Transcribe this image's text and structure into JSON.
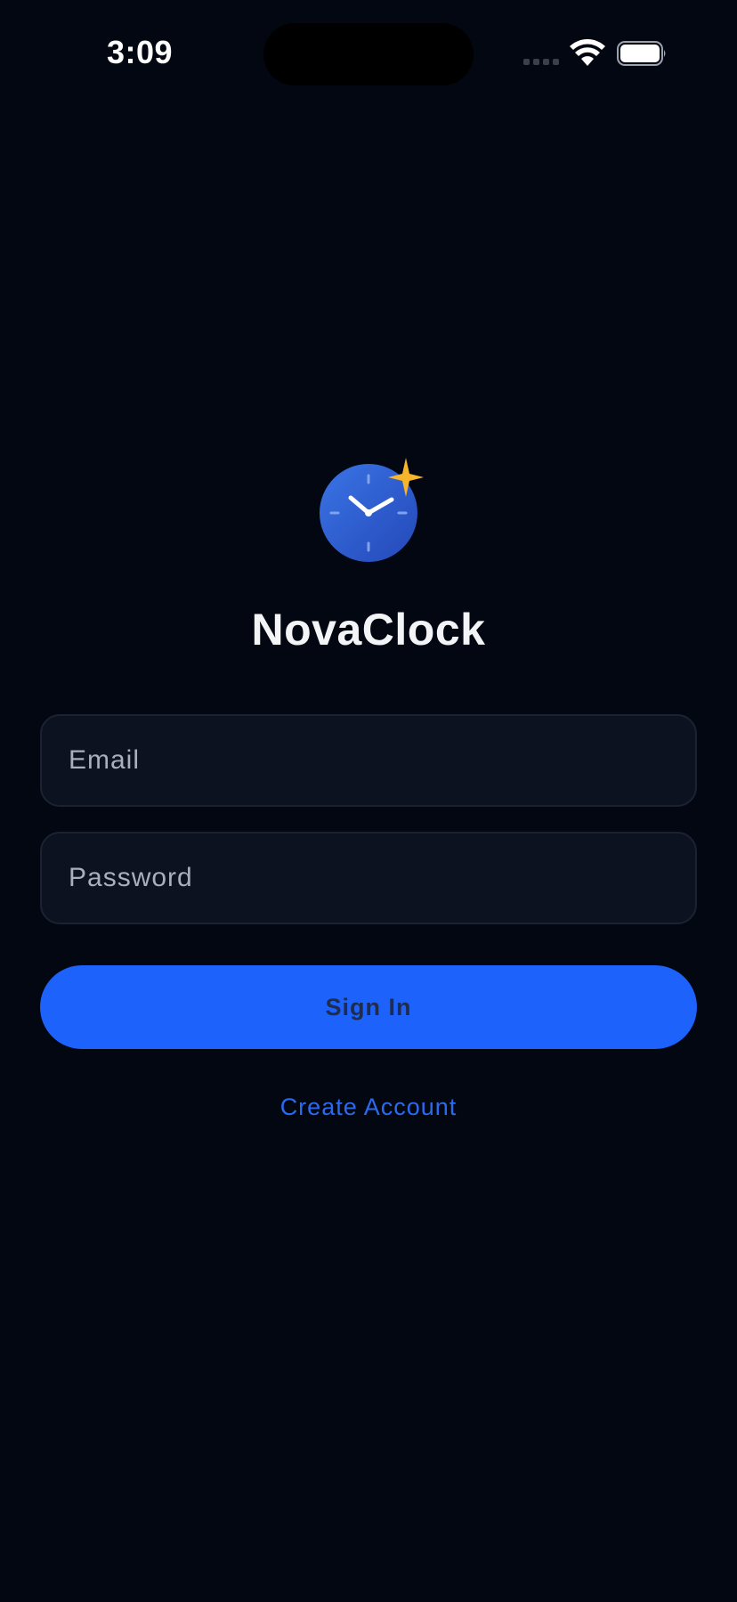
{
  "status_bar": {
    "time": "3:09",
    "icons": [
      "cellular-signal-icon",
      "wifi-icon",
      "battery-icon"
    ]
  },
  "app": {
    "name": "NovaClock",
    "logo_icon": "clock-sparkle-icon"
  },
  "form": {
    "email": {
      "placeholder": "Email",
      "value": ""
    },
    "password": {
      "placeholder": "Password",
      "value": ""
    },
    "sign_in_label": "Sign In",
    "create_account_label": "Create Account"
  },
  "colors": {
    "background": "#030712",
    "field_background": "#0c1220",
    "field_border": "#1b2333",
    "primary_button": "#1c62fb",
    "link": "#2a6af0",
    "logo_blue": "#2f5fd6",
    "sparkle": "#f6b52a"
  }
}
